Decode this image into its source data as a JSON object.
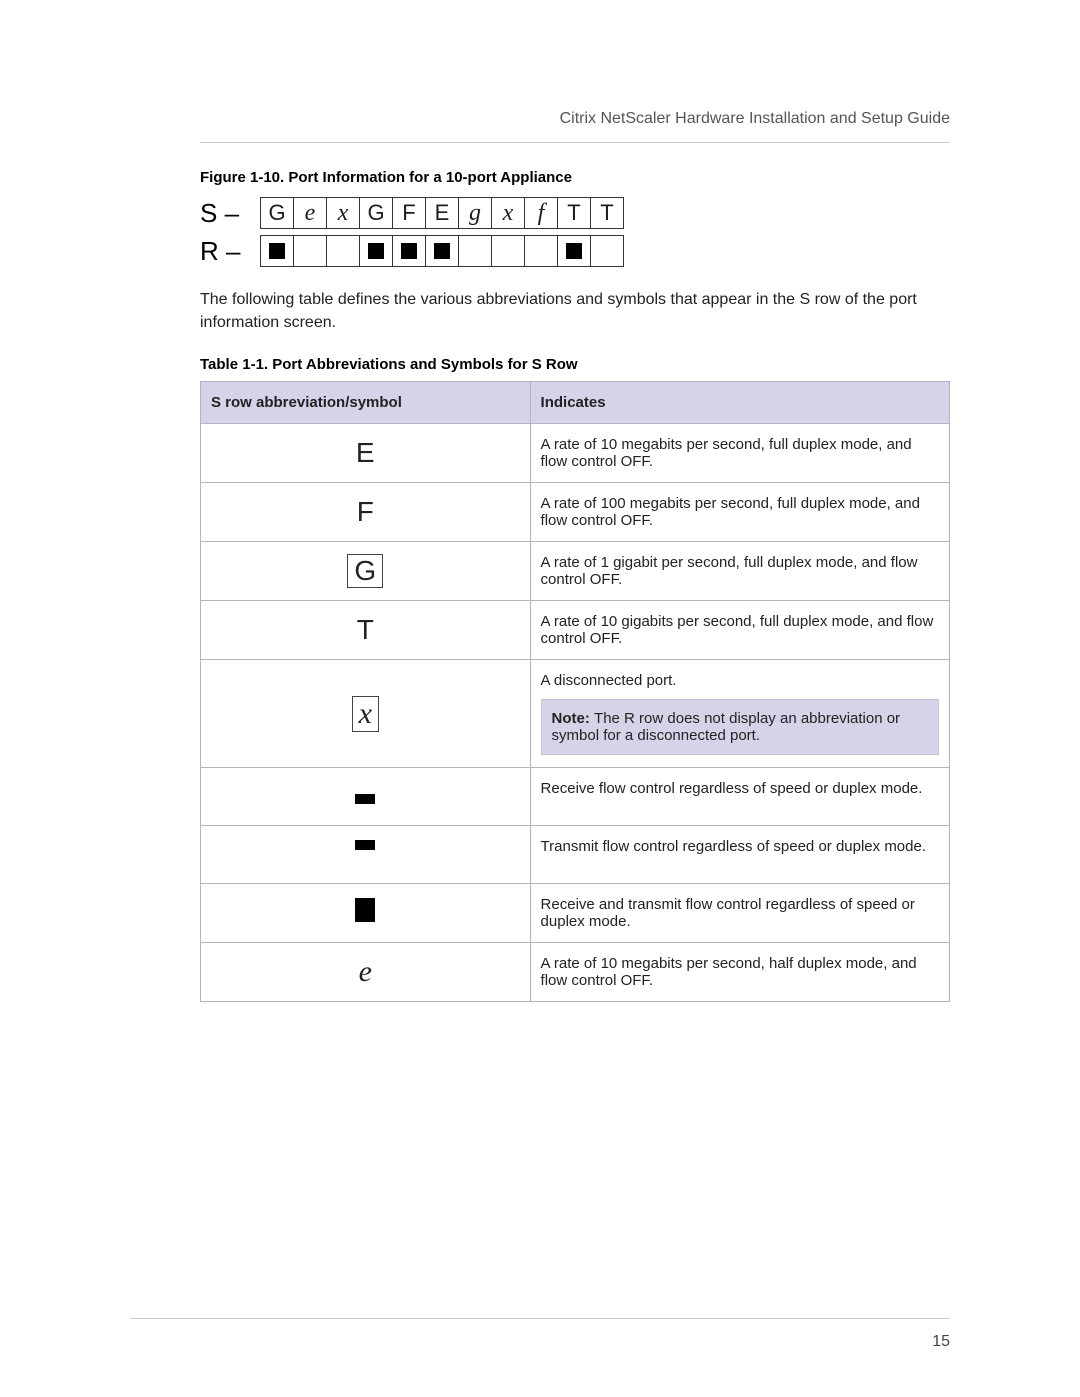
{
  "running_header": "Citrix NetScaler Hardware Installation and Setup Guide",
  "figure": {
    "caption": "Figure 1-10. Port Information for a 10-port Appliance",
    "s_lead": "S –",
    "r_lead": "R –",
    "s_cells": [
      "G",
      "e",
      "x",
      "G",
      "F",
      "E",
      "g",
      "x",
      "f",
      "T",
      "T"
    ],
    "r_cells": [
      "■",
      "□",
      "",
      "■",
      "■",
      "■",
      "□",
      "",
      "□",
      "■",
      "□"
    ]
  },
  "intro_para": "The following table defines the various abbreviations and symbols that appear in the S row of the port information screen.",
  "table": {
    "caption": "Table 1-1. Port Abbreviations and Symbols for S Row",
    "headers": [
      "S row abbreviation/symbol",
      "Indicates"
    ],
    "rows": [
      {
        "symbol": "E",
        "symtype": "letter",
        "indicates": "A rate of 10 megabits per second, full duplex mode, and flow control OFF."
      },
      {
        "symbol": "F",
        "symtype": "letter",
        "indicates": "A rate of 100 megabits per second, full duplex mode, and flow control OFF."
      },
      {
        "symbol": "G",
        "symtype": "letter-box",
        "indicates": "A rate of 1 gigabit per second, full duplex mode, and flow control OFF."
      },
      {
        "symbol": "T",
        "symtype": "letter",
        "indicates": "A rate of 10 gigabits per second, full duplex mode, and flow control OFF."
      },
      {
        "symbol": "x",
        "symtype": "serif-ital-box",
        "indicates": "A disconnected port.",
        "note": "The R row does not display an abbreviation or symbol for a disconnected port."
      },
      {
        "symbol": "rect-bottom",
        "symtype": "shape",
        "indicates": "Receive flow control regardless of speed or duplex mode."
      },
      {
        "symbol": "rect-top",
        "symtype": "shape",
        "indicates": "Transmit flow control regardless of speed or duplex mode."
      },
      {
        "symbol": "rect-full",
        "symtype": "shape",
        "indicates": "Receive and transmit flow control regardless of speed or duplex mode."
      },
      {
        "symbol": "e",
        "symtype": "serif-ital",
        "indicates": "A rate of 10 megabits per second, half duplex mode, and flow control OFF."
      }
    ]
  },
  "note_label": "Note:",
  "page_number": "15"
}
